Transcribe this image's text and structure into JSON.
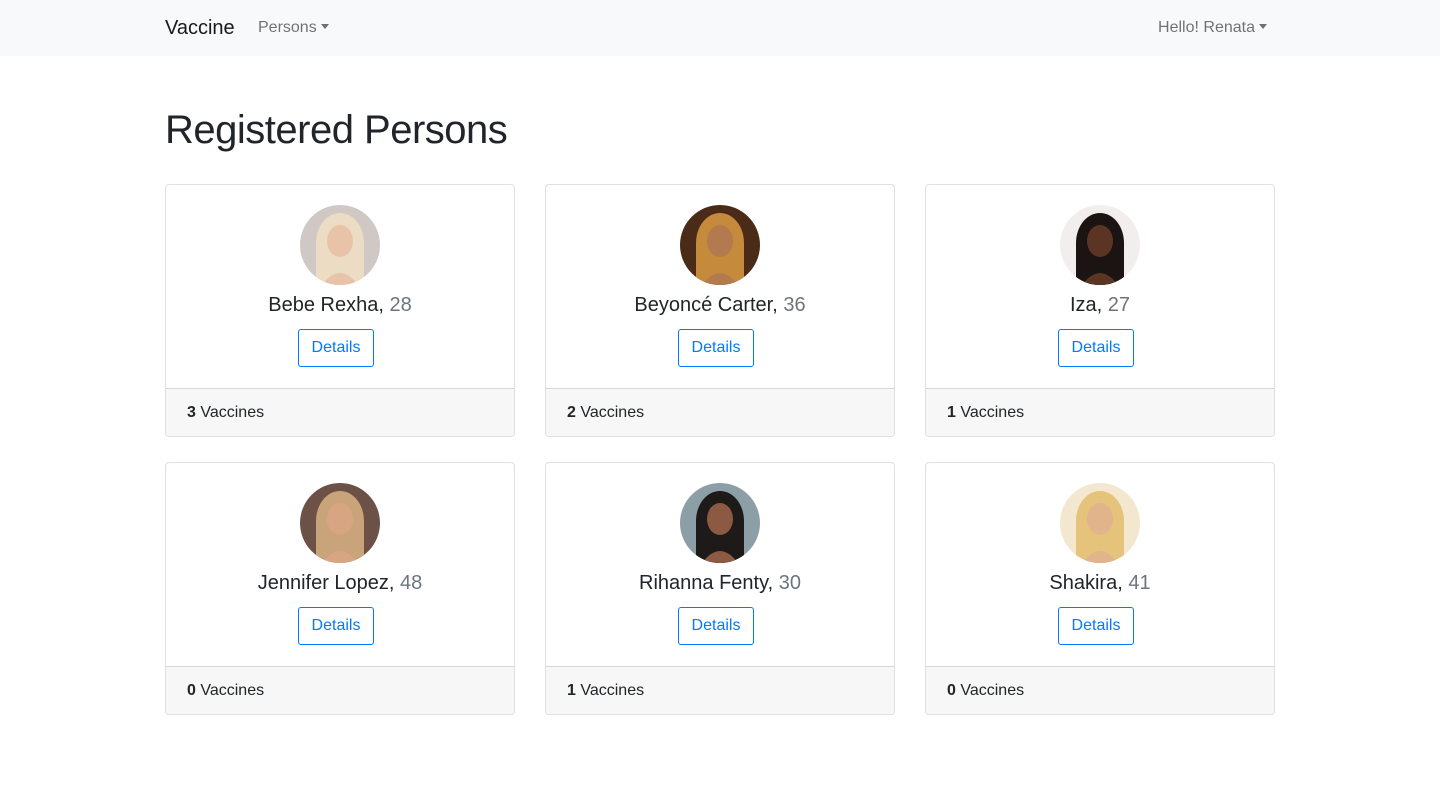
{
  "navbar": {
    "brand": "Vaccine",
    "persons_menu": "Persons",
    "user_menu": "Hello! Renata"
  },
  "page": {
    "title": "Registered Persons"
  },
  "persons": [
    {
      "name": "Bebe Rexha",
      "age": "28",
      "details_label": "Details",
      "vaccine_count": "3",
      "vaccine_label": "Vaccines",
      "hair": "#ecdcc4",
      "skin": "#e9c3a8",
      "bg": "#cfc8c4"
    },
    {
      "name": "Beyoncé Carter",
      "age": "36",
      "details_label": "Details",
      "vaccine_count": "2",
      "vaccine_label": "Vaccines",
      "hair": "#c58a3c",
      "skin": "#b47a4f",
      "bg": "#4a2b18"
    },
    {
      "name": "Iza",
      "age": "27",
      "details_label": "Details",
      "vaccine_count": "1",
      "vaccine_label": "Vaccines",
      "hair": "#1b1412",
      "skin": "#5c3424",
      "bg": "#f2eeee"
    },
    {
      "name": "Jennifer Lopez",
      "age": "48",
      "details_label": "Details",
      "vaccine_count": "0",
      "vaccine_label": "Vaccines",
      "hair": "#c9a37a",
      "skin": "#d8a583",
      "bg": "#6b5146"
    },
    {
      "name": "Rihanna Fenty",
      "age": "30",
      "details_label": "Details",
      "vaccine_count": "1",
      "vaccine_label": "Vaccines",
      "hair": "#1e1a1a",
      "skin": "#8c5a42",
      "bg": "#8c9ea6"
    },
    {
      "name": "Shakira",
      "age": "41",
      "details_label": "Details",
      "vaccine_count": "0",
      "vaccine_label": "Vaccines",
      "hair": "#e5c37a",
      "skin": "#e2b48c",
      "bg": "#f3e7cf"
    }
  ]
}
